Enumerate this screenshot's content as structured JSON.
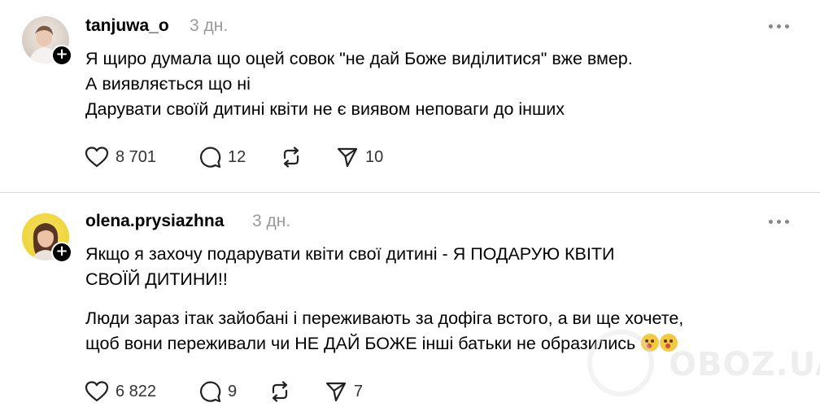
{
  "posts": [
    {
      "username": "tanjuwa_o",
      "time": "3 дн.",
      "paragraphs": [
        [
          "Я щиро думала що оцей совок \"не дай Боже виділитися\" вже вмер.",
          "А виявляється що ні",
          "Дарувати своїй дитині квіти не є виявом неповаги до інших"
        ]
      ],
      "likes": "8 701",
      "comments": "12",
      "shares": "10"
    },
    {
      "username": "olena.prysiazhna",
      "time": "3 дн.",
      "paragraphs": [
        [
          "Якщо я захочу подарувати квіти свої дитині - Я ПОДАРУЮ КВІТИ",
          "СВОЇЙ ДИТИНИ!!"
        ],
        [
          "Люди зараз ітак зайобані і переживають за дофіга встого, а ви ще хочете,",
          "щоб вони переживали чи НЕ ДАЙ БОЖЕ інші батьки не образились"
        ]
      ],
      "likes": "6 822",
      "comments": "9",
      "shares": "7"
    }
  ],
  "watermark": "OBOZ.UA",
  "icons": {
    "like": "heart-icon",
    "comment": "comment-bubble-icon",
    "repost": "repost-icon",
    "share": "send-icon",
    "more": "more-dots-icon",
    "follow": "plus-icon",
    "emoji": "upside-down-face-emoji"
  }
}
